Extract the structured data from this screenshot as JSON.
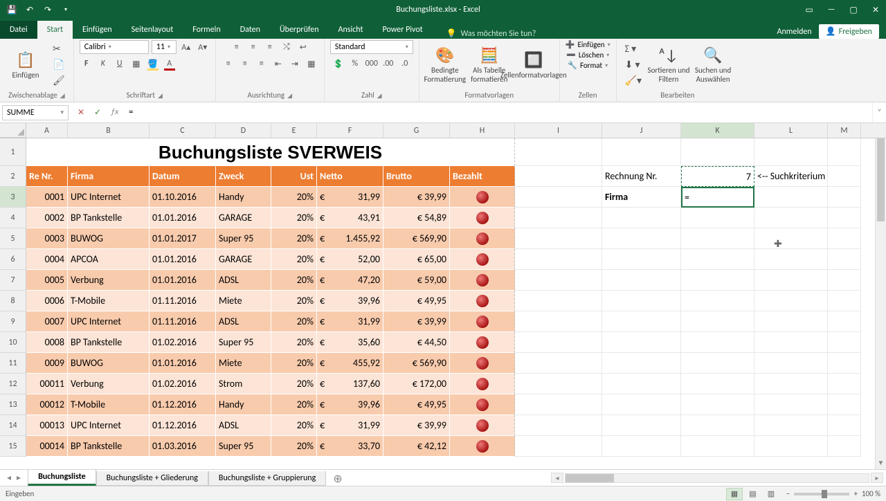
{
  "app": {
    "title": "Buchungsliste.xlsx - Excel"
  },
  "ribbon": {
    "tabs": {
      "file": "Datei",
      "start": "Start",
      "einfuegen": "Einfügen",
      "seitenlayout": "Seitenlayout",
      "formeln": "Formeln",
      "daten": "Daten",
      "ueberpruefen": "Überprüfen",
      "ansicht": "Ansicht",
      "powerpivot": "Power Pivot"
    },
    "tellme": "Was möchten Sie tun?",
    "anmelden": "Anmelden",
    "freigeben": "Freigeben",
    "groups": {
      "clipboard": {
        "paste": "Einfügen",
        "label": "Zwischenablage"
      },
      "font": {
        "name": "Calibri",
        "size": "11",
        "label": "Schriftart",
        "bold": "F",
        "italic": "K",
        "underline": "U"
      },
      "alignment": {
        "label": "Ausrichtung"
      },
      "number": {
        "format": "Standard",
        "label": "Zahl"
      },
      "styles": {
        "cond": "Bedingte Formatierung",
        "table": "Als Tabelle formatieren",
        "cell": "Zellenformatvorlagen",
        "label": "Formatvorlagen"
      },
      "cells": {
        "insert": "Einfügen",
        "delete": "Löschen",
        "format": "Format",
        "label": "Zellen"
      },
      "editing": {
        "sort": "Sortieren und Filtern",
        "find": "Suchen und Auswählen",
        "label": "Bearbeiten"
      }
    }
  },
  "formula_bar": {
    "namebox": "SUMME",
    "value": "="
  },
  "columns": [
    "A",
    "B",
    "C",
    "D",
    "E",
    "F",
    "G",
    "H",
    "I",
    "J",
    "K",
    "L",
    "M"
  ],
  "sheet_title": "Buchungsliste SVERWEIS",
  "headers": {
    "re": "Re Nr.",
    "firma": "Firma",
    "datum": "Datum",
    "zweck": "Zweck",
    "ust": "Ust",
    "netto": "Netto",
    "brutto": "Brutto",
    "bezahlt": "Bezahlt"
  },
  "lookup": {
    "rechnung_label": "Rechnung Nr.",
    "rechnung_val": "7",
    "hint": "<-- Suchkriterium",
    "firma_label": "Firma",
    "firma_val": "="
  },
  "data": [
    {
      "re": "0001",
      "firma": "UPC Internet",
      "datum": "01.10.2016",
      "zweck": "Handy",
      "ust": "20%",
      "netto": "31,99",
      "brutto": "€ 39,99"
    },
    {
      "re": "0002",
      "firma": "BP Tankstelle",
      "datum": "01.01.2016",
      "zweck": "GARAGE",
      "ust": "20%",
      "netto": "43,91",
      "brutto": "€ 54,89"
    },
    {
      "re": "0003",
      "firma": "BUWOG",
      "datum": "01.01.2017",
      "zweck": "Super 95",
      "ust": "20%",
      "netto": "1.455,92",
      "brutto": "€ 569,90"
    },
    {
      "re": "0004",
      "firma": "APCOA",
      "datum": "01.01.2016",
      "zweck": "GARAGE",
      "ust": "20%",
      "netto": "52,00",
      "brutto": "€ 65,00"
    },
    {
      "re": "0005",
      "firma": "Verbung",
      "datum": "01.01.2016",
      "zweck": "ADSL",
      "ust": "20%",
      "netto": "47,20",
      "brutto": "€ 59,00"
    },
    {
      "re": "0006",
      "firma": "T-Mobile",
      "datum": "01.11.2016",
      "zweck": "Miete",
      "ust": "20%",
      "netto": "39,96",
      "brutto": "€ 49,95"
    },
    {
      "re": "0007",
      "firma": "UPC Internet",
      "datum": "01.11.2016",
      "zweck": "ADSL",
      "ust": "20%",
      "netto": "31,99",
      "brutto": "€ 39,99"
    },
    {
      "re": "0008",
      "firma": "BP Tankstelle",
      "datum": "01.02.2016",
      "zweck": "Super 95",
      "ust": "20%",
      "netto": "35,60",
      "brutto": "€ 44,50"
    },
    {
      "re": "0009",
      "firma": "BUWOG",
      "datum": "01.01.2016",
      "zweck": "Miete",
      "ust": "20%",
      "netto": "455,92",
      "brutto": "€ 569,90"
    },
    {
      "re": "00011",
      "firma": "Verbung",
      "datum": "01.02.2016",
      "zweck": "Strom",
      "ust": "20%",
      "netto": "137,60",
      "brutto": "€ 172,00"
    },
    {
      "re": "00012",
      "firma": "T-Mobile",
      "datum": "01.12.2016",
      "zweck": "Handy",
      "ust": "20%",
      "netto": "39,96",
      "brutto": "€ 49,95"
    },
    {
      "re": "00013",
      "firma": "UPC Internet",
      "datum": "01.12.2016",
      "zweck": "ADSL",
      "ust": "20%",
      "netto": "31,99",
      "brutto": "€ 39,99"
    },
    {
      "re": "00014",
      "firma": "BP Tankstelle",
      "datum": "01.03.2016",
      "zweck": "Super 95",
      "ust": "20%",
      "netto": "33,70",
      "brutto": "€ 42,12"
    }
  ],
  "sheets": {
    "s1": "Buchungsliste",
    "s2": "Buchungsliste + Gliederung",
    "s3": "Buchungsliste + Gruppierung"
  },
  "status": {
    "mode": "Eingeben",
    "zoom": "100 %"
  }
}
